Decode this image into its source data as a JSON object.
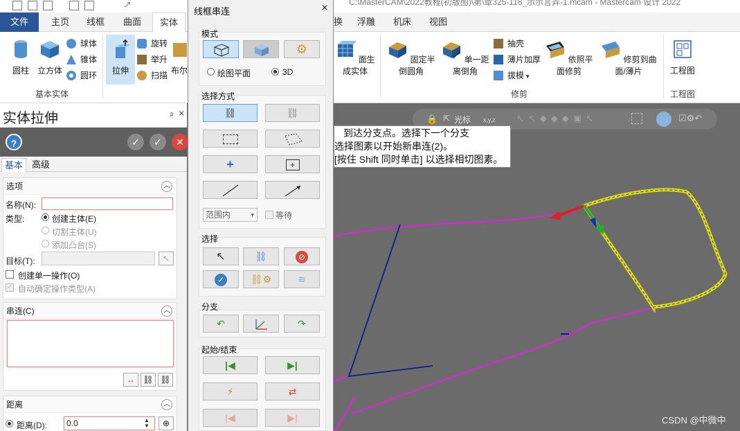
{
  "titlebar": {
    "text": "C:\\MasterCAM\\2022教程(初版图)\\第\\章325-118_示示言弄-1.mcam - Mastercam 设计 2022"
  },
  "tabs": [
    {
      "label": "文件"
    },
    {
      "label": "主页"
    },
    {
      "label": "线框"
    },
    {
      "label": "曲面"
    },
    {
      "label": "实体"
    },
    {
      "label": "换"
    },
    {
      "label": "浮雕"
    },
    {
      "label": "机床"
    },
    {
      "label": "视图"
    }
  ],
  "ribbon": {
    "basic": {
      "cylinder": "圆柱",
      "cube": "立方体",
      "sphere": "球体",
      "cone": "锥体",
      "torus": "圆环",
      "group": "基本实体"
    },
    "create": {
      "extrude": "拉伸",
      "revolve": "旋转",
      "loft": "举升",
      "sweep": "扫描",
      "boolean": "布尔"
    },
    "gen_solid": "面生成实体",
    "modify": {
      "fixed_fillet": "固定半倒圆角",
      "chamfer": "单一距离倒角",
      "shell": "抽壳",
      "thicken": "薄片加厚",
      "draft": "拔模",
      "trim_plane": "依照平面修剪",
      "trim_surface": "修剪到曲面/薄片",
      "group": "修剪"
    },
    "drawing": {
      "label": "工程图",
      "group": "工程图"
    }
  },
  "panel": {
    "title": "实体拉伸",
    "pin": "ᵖ",
    "close": "×",
    "tabs": [
      "基本",
      "高级"
    ],
    "options": {
      "header": "选项",
      "name_label": "名称(N):",
      "name_value": "",
      "type_label": "类型:",
      "type_create": "创建主体(E)",
      "type_cut": "切割主体(U)",
      "type_boss": "添加凸台(S)",
      "target_label": "目标(T):",
      "single_op": "创建单一操作(O)",
      "auto_type": "自动确定操作类型(A)"
    },
    "chain": {
      "header": "串连(C)"
    },
    "distance": {
      "header": "距离",
      "label": "距离(D):",
      "value": "0.0"
    }
  },
  "dialog": {
    "title": "线框串连",
    "close": "×",
    "mode": {
      "label": "模式",
      "radio_plane": "绘图平面",
      "radio_3d": "3D"
    },
    "select_method": {
      "label": "选择方式",
      "range_value": "范围内",
      "wait_label": "等待"
    },
    "select": {
      "label": "选择"
    },
    "branch": {
      "label": "分支"
    },
    "startend": {
      "label": "起始/结束"
    }
  },
  "prompt": {
    "lines": [
      "到达分支点。选择下一个分支",
      "选择图素以开始新串连(2)。",
      "[按住 Shift 同时单击] 以选择相切图素。"
    ]
  },
  "graphics": {
    "toolbar_label": "光标",
    "coord_label": "x,y,z"
  },
  "watermark": "CSDN @中微中"
}
